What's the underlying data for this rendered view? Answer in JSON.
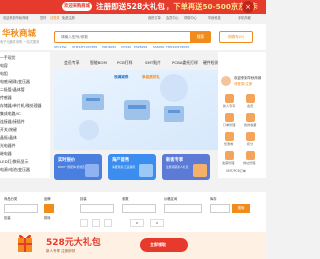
{
  "promo": {
    "badge": "欢迎来购商城",
    "left": "注册即送528大礼包",
    "right": "，下单再送50-500京东E卡",
    "close": "×"
  },
  "top_nav": [
    "欢迎来到华秋商城",
    "您好",
    "请登录",
    "免费注册",
    "我的订单",
    "会员中心",
    "帮助中心",
    "华秋科技",
    "手机商城"
  ],
  "header": {
    "logo": "华秋商城",
    "logo_sub": "电子元器件采购 一站式服务",
    "search_placeholder": "请输入型号/参数",
    "search_button": "搜索",
    "cart_button": "购物车(0)",
    "keywords": [
      "STC15W",
      "STM32F103C8T6",
      "MPU6050",
      "CH340",
      "ESP8266",
      "SS8050",
      "TMS320F28035"
    ]
  },
  "categories": [
    "一手现货",
    "电容",
    "电阻",
    "电感/磁珠/变压器",
    "二极管/晶体管",
    "传感器",
    "存储器/单片机/微处理器",
    "集成电路/IC",
    "连接器/接插件",
    "开关/按键",
    "晶振/晶体",
    "光电器件",
    "继电器",
    "LED灯/数码显示",
    "电源/电池/变压器",
    "工具/仪器/辅料"
  ],
  "nav_tabs": [
    "会员专享",
    "智能BOM",
    "PCB打样",
    "SMT贴片",
    "PCBA委托打样",
    "硬件检测"
  ],
  "banner": {
    "promo_text_a": "领满减券",
    "promo_text_b": "享品质好礼"
  },
  "tiles": [
    {
      "title": "实时报价",
      "sub": "BOM一键配单,智能匹配"
    },
    {
      "title": "海产首秀",
      "sub": "海量现货,正品保障"
    },
    {
      "title": "新客专享",
      "sub": "注册领取新人礼包"
    }
  ],
  "user_panel": {
    "greeting": "欢迎来到华秋商城",
    "prompt": "请登录/注册",
    "quick": [
      {
        "label": "新人专享"
      },
      {
        "label": "会员"
      },
      {
        "label": "订单管理"
      },
      {
        "label": "我的收藏"
      },
      {
        "label": "优惠券"
      },
      {
        "label": "积分"
      },
      {
        "label": "发票管理"
      },
      {
        "label": "地址管理"
      },
      {
        "label": "SMT/PCB订单"
      }
    ]
  },
  "filter": {
    "labels": [
      "商品分类",
      "品牌",
      "封装",
      "参数",
      "价格区间",
      "库存",
      "包装",
      "排序"
    ],
    "value": "0",
    "button": "搜索"
  },
  "bottom_ad": {
    "main": "528元大礼包",
    "sub": "新人专享 注册即领",
    "cta": "立即领取"
  }
}
